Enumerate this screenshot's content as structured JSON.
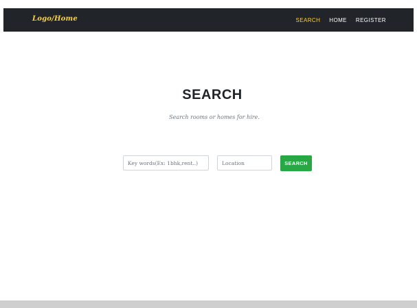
{
  "navbar": {
    "logo_text": "Logo/Home",
    "links": [
      {
        "label": "SEARCH",
        "active": true
      },
      {
        "label": "HOME",
        "active": false
      },
      {
        "label": "REGISTER",
        "active": false
      }
    ]
  },
  "hero": {
    "title": "SEARCH",
    "subtitle": "Search rooms or homes for hire."
  },
  "search_form": {
    "keywords_placeholder": "Key words(Ex: 1bhk,rent..)",
    "keywords_value": "",
    "location_placeholder": "Location",
    "location_value": "",
    "button_label": "SEARCH"
  },
  "colors": {
    "navbar_bg": "#212529",
    "accent": "#fed136",
    "button_green": "#28a745",
    "footer_bg": "#cfcfcf"
  }
}
